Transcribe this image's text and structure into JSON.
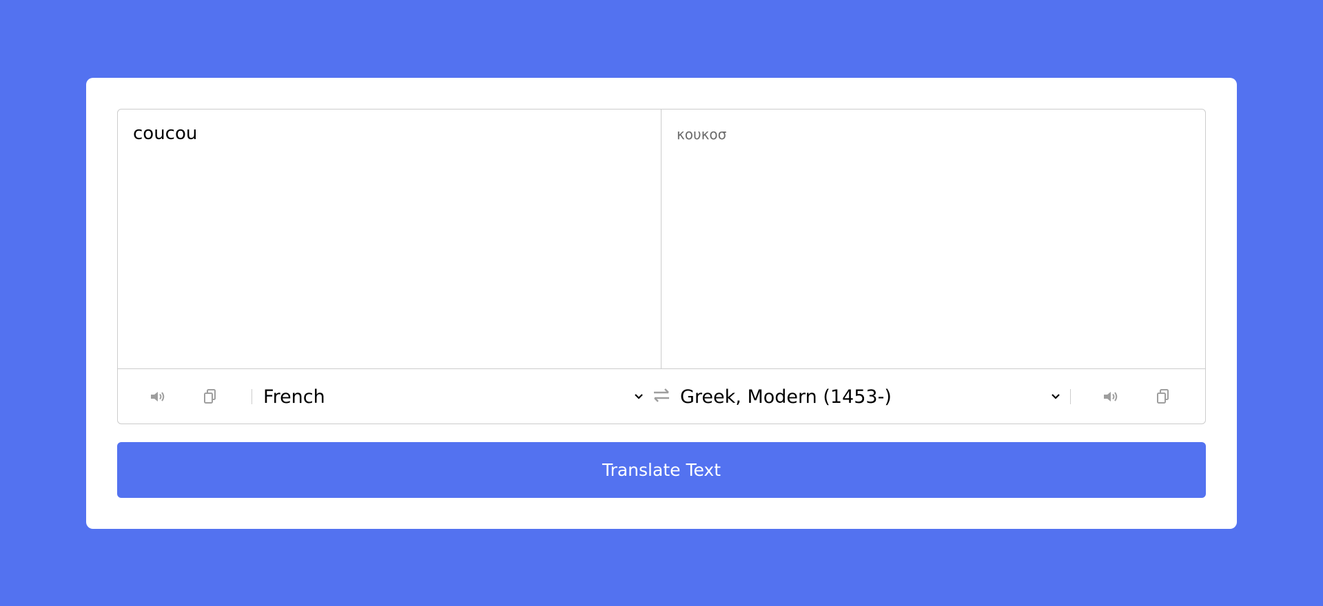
{
  "input": {
    "from_text": "coucou",
    "to_text": "κουκοσ"
  },
  "controls": {
    "from_language": "French",
    "to_language": "Greek, Modern (1453-)"
  },
  "icons": {
    "speak": "volume-icon",
    "copy": "copy-icon",
    "exchange": "exchange-icon",
    "chevron": "chevron-down-icon"
  },
  "actions": {
    "translate_label": "Translate Text"
  },
  "colors": {
    "background": "#5372F0",
    "button": "#5372F0",
    "border": "#cccccc",
    "icon": "#9e9e9e"
  }
}
